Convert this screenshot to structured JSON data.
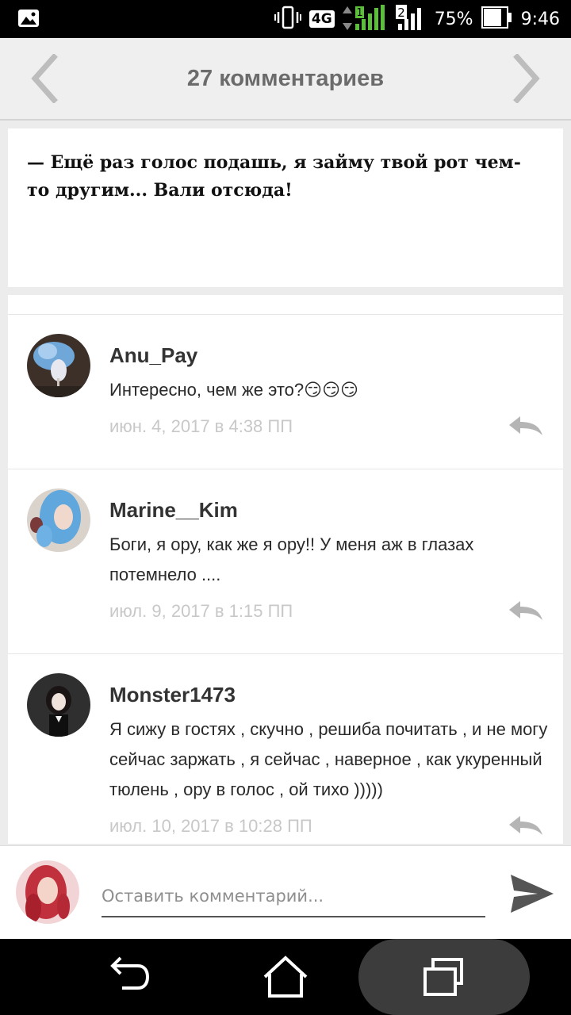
{
  "status_bar": {
    "network_type": "4G",
    "sim_number": "1",
    "sim2_number": "2",
    "battery_percent": "75%",
    "time": "9:46",
    "icons": [
      "gallery-notification-icon",
      "vibrate-icon",
      "signal-icon",
      "battery-icon"
    ]
  },
  "header": {
    "title": "27 комментариев"
  },
  "quote": {
    "text": "— Ещё раз голос подашь, я займу твой рот чем-то другим... Вали отсюда!"
  },
  "comments": [
    {
      "author": "Anu_Pay",
      "text": "Интересно, чем же это?😏😏😏",
      "date": "июн. 4, 2017 в 4:38 ПП"
    },
    {
      "author": "Marine__Kim",
      "text": "Боги, я ору, как же я ору!! У меня аж в глазах потемнело ....",
      "date": "июл. 9, 2017 в 1:15 ПП"
    },
    {
      "author": "Monster1473",
      "text": "Я сижу в гостях , скучно , решиба почитать , и не могу сейчас заржать , я сейчас , наверное , как укуренный тюлень , ору в голос  , ой тихо )))))",
      "date": "июл. 10, 2017 в 10:28 ПП"
    }
  ],
  "composer": {
    "placeholder": "Оставить комментарий..."
  },
  "colors": {
    "header_bg": "#efefef",
    "title_gray": "#6b6b6b",
    "date_gray": "#c8c8c8",
    "reply_gray": "#b5b5b5"
  }
}
